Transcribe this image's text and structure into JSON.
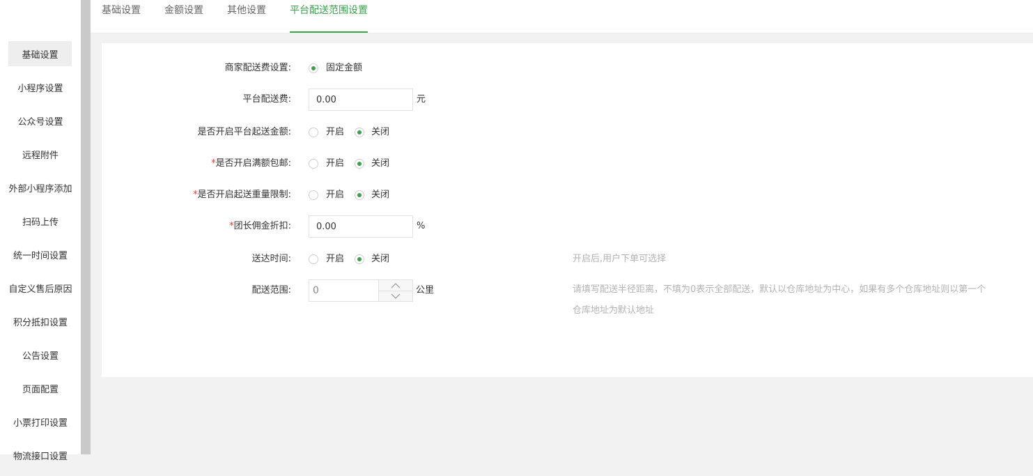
{
  "sidebar": {
    "items": [
      {
        "label": "基础设置"
      },
      {
        "label": "小程序设置"
      },
      {
        "label": "公众号设置"
      },
      {
        "label": "远程附件"
      },
      {
        "label": "外部小程序添加"
      },
      {
        "label": "扫码上传"
      },
      {
        "label": "统一时间设置"
      },
      {
        "label": "自定义售后原因"
      },
      {
        "label": "积分抵扣设置"
      },
      {
        "label": "公告设置"
      },
      {
        "label": "页面配置"
      },
      {
        "label": "小票打印设置"
      },
      {
        "label": "物流接口设置"
      }
    ]
  },
  "tabs": [
    {
      "label": "基础设置"
    },
    {
      "label": "金额设置"
    },
    {
      "label": "其他设置"
    },
    {
      "label": "平台配送范围设置"
    }
  ],
  "form": {
    "fee_mode": {
      "label": "商家配送费设置:",
      "option": "固定金额"
    },
    "platform_fee": {
      "label": "平台配送费:",
      "value": "0.00",
      "unit": "元"
    },
    "min_order": {
      "label": "是否开启平台起送金额:",
      "on": "开启",
      "off": "关闭"
    },
    "free_shipping": {
      "required": "*",
      "label": "是否开启满额包邮:",
      "on": "开启",
      "off": "关闭"
    },
    "weight_limit": {
      "required": "*",
      "label": "是否开启起送重量限制:",
      "on": "开启",
      "off": "关闭"
    },
    "commission": {
      "required": "*",
      "label": "团长佣金折扣:",
      "value": "0.00",
      "unit": "%"
    },
    "delivery_time": {
      "label": "送达时间:",
      "on": "开启",
      "off": "关闭",
      "hint": "开启后,用户下单可选择"
    },
    "range": {
      "label": "配送范围:",
      "value": "0",
      "unit": "公里",
      "hint_line1": "请填写配送半径距离，不填为0表示全部配送，默认以仓库地址为中心，如果有多个仓库地址则以第一个",
      "hint_line2": "仓库地址为默认地址"
    }
  },
  "colors": {
    "accent": "#3aa24a",
    "required": "#e0403a",
    "hint": "#b3b3b3"
  }
}
